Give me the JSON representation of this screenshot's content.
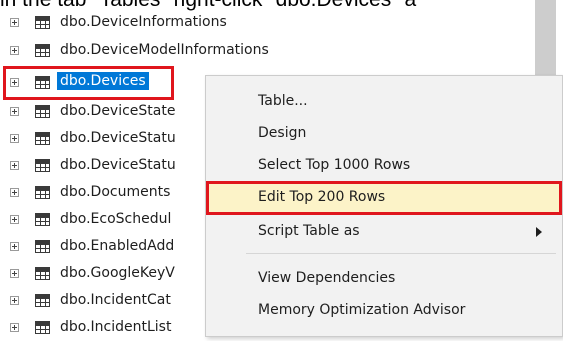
{
  "caption": "in the tab \"Tables\" right-click \"dbo.Devices\" a",
  "tree": {
    "items": [
      {
        "label": "dbo.DeviceInformations"
      },
      {
        "label": "dbo.DeviceModelInformations"
      },
      {
        "label": "dbo.Devices"
      },
      {
        "label": "dbo.DeviceState"
      },
      {
        "label": "dbo.DeviceStatu"
      },
      {
        "label": "dbo.DeviceStatu"
      },
      {
        "label": "dbo.Documents"
      },
      {
        "label": "dbo.EcoSchedul"
      },
      {
        "label": "dbo.EnabledAdd"
      },
      {
        "label": "dbo.GoogleKeyV"
      },
      {
        "label": "dbo.IncidentCat"
      },
      {
        "label": "dbo.IncidentList"
      }
    ]
  },
  "menu": {
    "items": [
      {
        "label": "Table..."
      },
      {
        "label": "Design"
      },
      {
        "label": "Select Top 1000 Rows"
      },
      {
        "label": "Edit Top 200 Rows"
      },
      {
        "label": "Script Table as"
      },
      {
        "label": "View Dependencies"
      },
      {
        "label": "Memory Optimization Advisor"
      }
    ]
  },
  "colors": {
    "highlight_border": "#e0161d",
    "selection": "#0078d7",
    "hover": "#fcf3c8"
  }
}
